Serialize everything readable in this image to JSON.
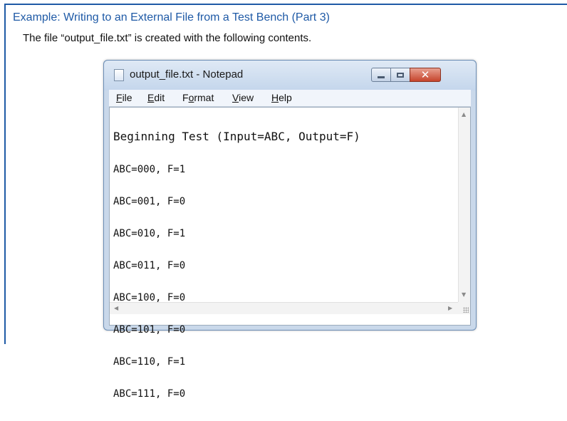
{
  "slide": {
    "title": "Example: Writing to an External File from a Test Bench (Part 3)",
    "subtitle": "The file “output_file.txt” is created with the following contents.",
    "accent_color": "#1f5aa6"
  },
  "window": {
    "title": "output_file.txt - Notepad",
    "app_icon": "notepad-icon",
    "controls": {
      "minimize_icon": "minimize-icon",
      "maximize_icon": "maximize-icon",
      "close_icon": "close-icon",
      "close_glyph": "✕"
    },
    "menu": [
      {
        "mnemonic": "F",
        "rest": "ile"
      },
      {
        "mnemonic": "E",
        "rest": "dit"
      },
      {
        "pre": "F",
        "mnemonic": "o",
        "rest": "rmat"
      },
      {
        "mnemonic": "V",
        "rest": "iew"
      },
      {
        "mnemonic": "H",
        "rest": "elp"
      }
    ],
    "content_lines": [
      "Beginning Test (Input=ABC, Output=F)",
      "ABC=000, F=1",
      "ABC=001, F=0",
      "ABC=010, F=1",
      "ABC=011, F=0",
      "ABC=100, F=0",
      "ABC=101, F=0",
      "ABC=110, F=1",
      "ABC=111, F=0"
    ]
  }
}
